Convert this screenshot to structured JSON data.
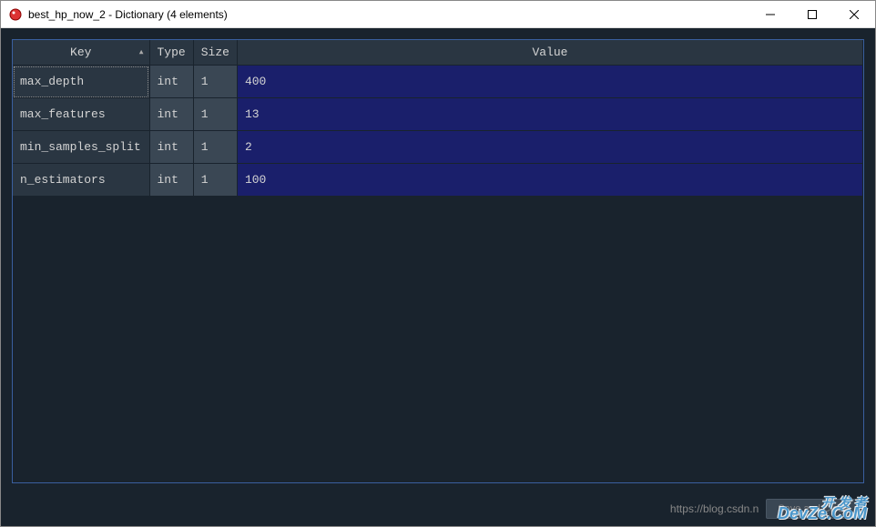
{
  "window": {
    "title": "best_hp_now_2 - Dictionary (4 elements)"
  },
  "table": {
    "headers": {
      "key": "Key",
      "type": "Type",
      "size": "Size",
      "value": "Value"
    },
    "rows": [
      {
        "key": "max_depth",
        "type": "int",
        "size": "1",
        "value": "400",
        "selected": true
      },
      {
        "key": "max_features",
        "type": "int",
        "size": "1",
        "value": "13",
        "selected": false
      },
      {
        "key": "min_samples_split",
        "type": "int",
        "size": "1",
        "value": "2",
        "selected": false
      },
      {
        "key": "n_estimators",
        "type": "int",
        "size": "1",
        "value": "100",
        "selected": false
      }
    ]
  },
  "footer": {
    "url": "https://blog.csdn.n",
    "button": "Save and Close"
  },
  "watermark": {
    "line1": "开 发 者",
    "line2": "DevZe.CoM"
  }
}
